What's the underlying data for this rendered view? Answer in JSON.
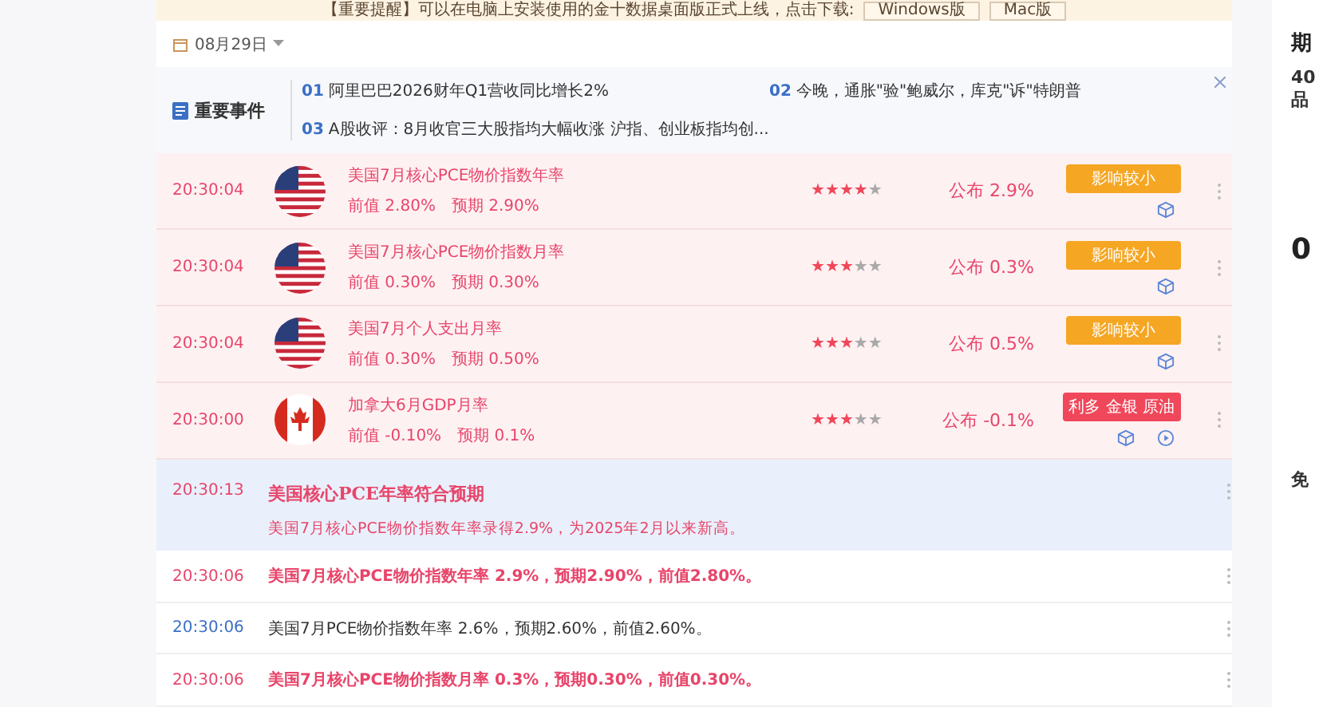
{
  "banner": {
    "text": "【重要提醒】可以在电脑上安装使用的金十数据桌面版正式上线，点击下载:",
    "buttons": [
      "Windows版",
      "Mac版"
    ]
  },
  "date": "08月29日",
  "events": {
    "title": "重要事件",
    "items": [
      {
        "index": "01",
        "text": "阿里巴巴2026财年Q1营收同比增长2%"
      },
      {
        "index": "02",
        "text": "今晚，通胀\"验\"鲍威尔，库克\"诉\"特朗普"
      },
      {
        "index": "03",
        "text": "A股收评：8月收官三大股指均大幅收涨 沪指、创业板指均创..."
      }
    ]
  },
  "rows": [
    {
      "kind": "data",
      "time": "20:30:04",
      "flag": {
        "kind": "us"
      },
      "title": "美国7月核心PCE物价指数年率",
      "previous": "前值 2.80%",
      "forecast": "预期 2.90%",
      "stars": 4,
      "actual": "公布 2.9%",
      "tag": {
        "text": "影响较小",
        "color": "#f5a623"
      },
      "video": false
    },
    {
      "kind": "data",
      "time": "20:30:04",
      "flag": {
        "kind": "us"
      },
      "title": "美国7月核心PCE物价指数月率",
      "previous": "前值 0.30%",
      "forecast": "预期 0.30%",
      "stars": 3,
      "actual": "公布 0.3%",
      "tag": {
        "text": "影响较小",
        "color": "#f5a623"
      },
      "video": false
    },
    {
      "kind": "data",
      "time": "20:30:04",
      "flag": {
        "kind": "us"
      },
      "title": "美国7月个人支出月率",
      "previous": "前值 0.30%",
      "forecast": "预期 0.50%",
      "stars": 3,
      "actual": "公布 0.5%",
      "tag": {
        "text": "影响较小",
        "color": "#f5a623"
      },
      "video": false
    },
    {
      "kind": "data",
      "time": "20:30:00",
      "flag": {
        "kind": "ca"
      },
      "title": "加拿大6月GDP月率",
      "previous": "前值 -0.10%",
      "forecast": "预期 0.1%",
      "stars": 3,
      "actual": "公布 -0.1%",
      "tag": {
        "text": "利多 金银 原油",
        "color": "#f0475a"
      },
      "video": true
    },
    {
      "kind": "headline",
      "time": "20:30:13",
      "title": "美国核心PCE年率符合预期",
      "text": "美国7月核心PCE物价指数年率录得2.9%，为2025年2月以来新高。"
    },
    {
      "kind": "flash",
      "time": "20:30:06",
      "important": true,
      "text": "美国7月核心PCE物价指数年率 2.9%，预期2.90%，前值2.80%。"
    },
    {
      "kind": "flash",
      "time": "20:30:06",
      "important": false,
      "text": "美国7月PCE物价指数年率 2.6%，预期2.60%，前值2.60%。"
    },
    {
      "kind": "flash",
      "time": "20:30:06",
      "important": true,
      "text": "美国7月核心PCE物价指数月率 0.3%，预期0.30%，前值0.30%。"
    }
  ],
  "side": {
    "title": "期",
    "subtitle": "40品",
    "figure": "0",
    "section": "免"
  }
}
